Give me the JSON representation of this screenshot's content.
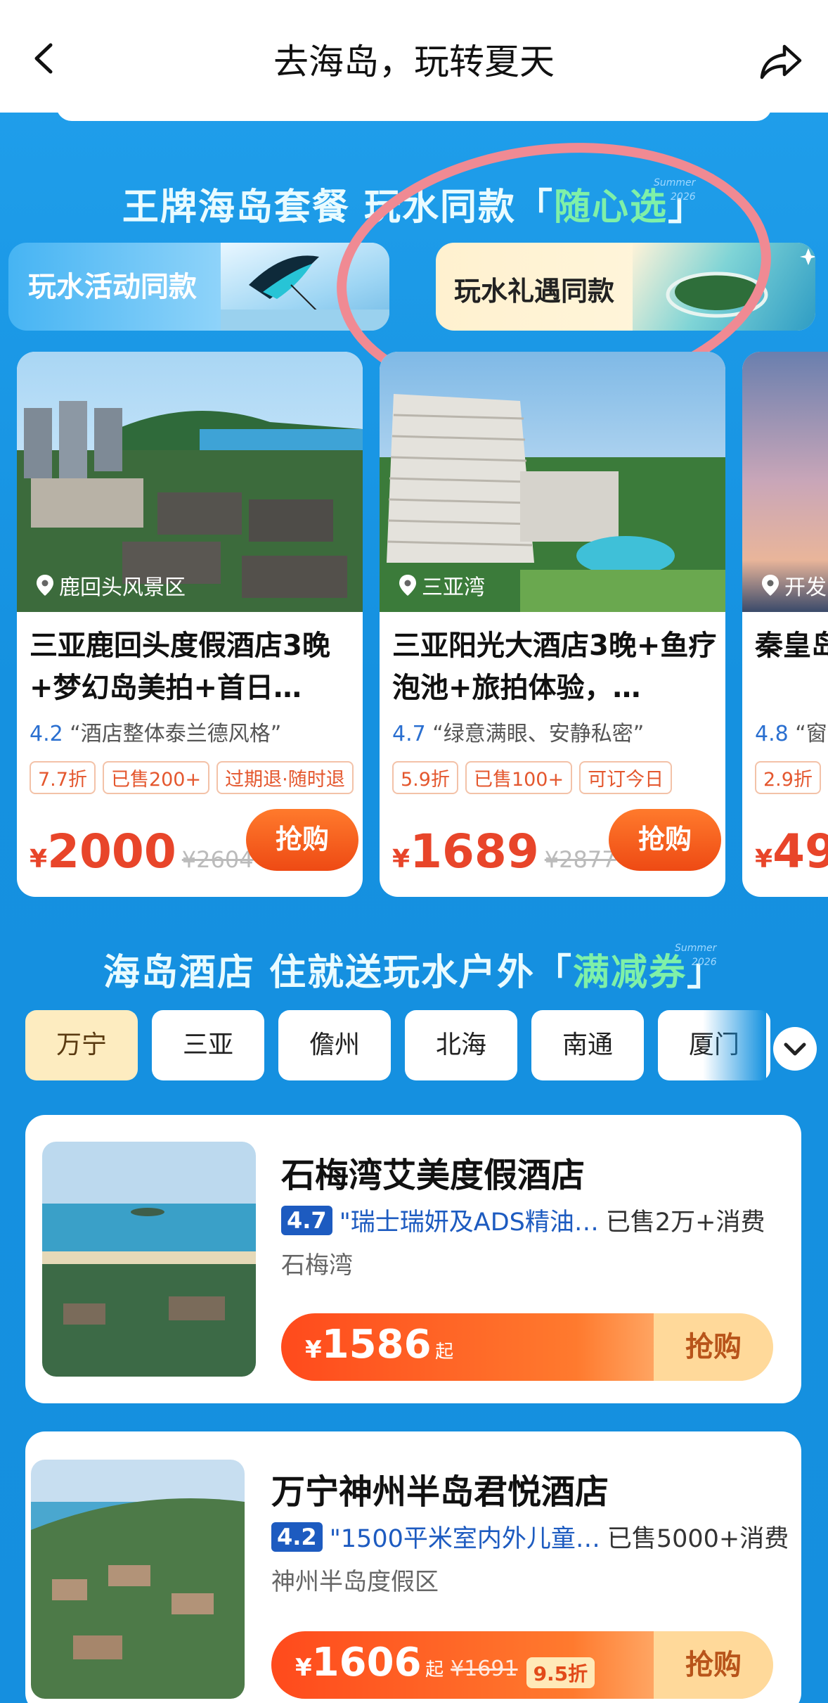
{
  "nav": {
    "title": "去海岛，玩转夏天"
  },
  "section1": {
    "title_main": "王牌海岛套餐 玩水同款",
    "title_hl": "随心选",
    "deco_top": "Summer",
    "deco_bottom": "2026"
  },
  "tabs": [
    {
      "label": "玩水活动同款"
    },
    {
      "label": "玩水礼遇同款"
    }
  ],
  "products": [
    {
      "location": "鹿回头风景区",
      "name": "三亚鹿回头度假酒店3晚+梦幻岛美拍+首日…",
      "score": "4.2",
      "quote": "“酒店整体泰兰德风格”",
      "tags": [
        "7.7折",
        "已售200+",
        "过期退·随时退"
      ],
      "currency": "¥",
      "price": "2000",
      "original": "¥2604",
      "buy": "抢购"
    },
    {
      "location": "三亚湾",
      "name": "三亚阳光大酒店3晚+鱼疗泡池+旅拍体验，…",
      "score": "4.7",
      "quote": "“绿意满眼、安静私密”",
      "tags": [
        "5.9折",
        "已售100+",
        "可订今日"
      ],
      "currency": "¥",
      "price": "1689",
      "original": "¥2877",
      "buy": "抢购"
    },
    {
      "location": "开发",
      "name": "秦皇岛店（金",
      "score": "4.8",
      "quote": "“窗",
      "tags": [
        "2.9折"
      ],
      "currency": "¥",
      "price": "49",
      "original": "",
      "buy": ""
    }
  ],
  "section2": {
    "title_main": "海岛酒店 住就送玩水户外",
    "title_hl": "满减券",
    "deco_top": "Summer",
    "deco_bottom": "2026"
  },
  "cities": [
    "万宁",
    "三亚",
    "儋州",
    "北海",
    "南通",
    "厦门"
  ],
  "hotels": [
    {
      "name": "石梅湾艾美度假酒店",
      "score": "4.7",
      "quote": "\"瑞士瑞妍及ADS精油…",
      "sold": "已售2万+消费",
      "area": "石梅湾",
      "currency": "¥",
      "price": "1586",
      "qi": "起",
      "original": "",
      "discount": "",
      "buy": "抢购"
    },
    {
      "name": "万宁神州半岛君悦酒店",
      "score": "4.2",
      "quote": "\"1500平米室内外儿童…",
      "sold": "已售5000+消费",
      "area": "神州半岛度假区",
      "currency": "¥",
      "price": "1606",
      "qi": "起",
      "original": "¥1691",
      "discount": "9.5折",
      "buy": "抢购"
    }
  ]
}
